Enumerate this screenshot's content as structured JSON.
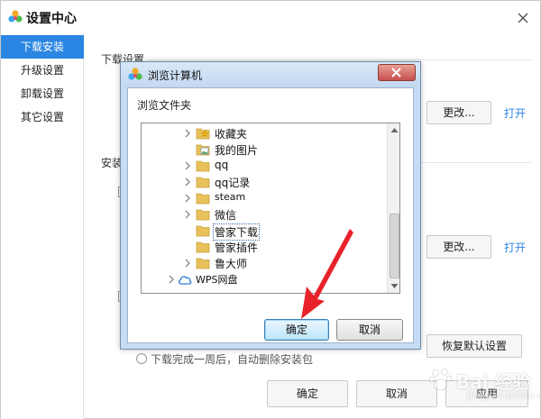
{
  "window": {
    "title": "设置中心"
  },
  "sidebar": {
    "items": [
      {
        "label": "下载安装",
        "active": true
      },
      {
        "label": "升级设置",
        "active": false
      },
      {
        "label": "卸载设置",
        "active": false
      },
      {
        "label": "其它设置",
        "active": false
      }
    ]
  },
  "content": {
    "download_section_title": "下载设置",
    "install_section_partial": "安装",
    "change_button_label": "更改...",
    "open_link_label": "打开",
    "restore_default_label": "恢复默认设置",
    "partial_option_text": "下载完成一周后，自动删除安装包",
    "ok_label": "确定",
    "cancel_label": "取消",
    "apply_label": "应用"
  },
  "dialog": {
    "title": "浏览计算机",
    "description": "浏览文件夹",
    "tree": [
      {
        "label": "收藏夹",
        "icon": "star-folder-icon",
        "expandable": true,
        "selected": false
      },
      {
        "label": "我的图片",
        "icon": "picture-folder-icon",
        "expandable": false,
        "selected": false
      },
      {
        "label": "qq",
        "icon": "folder-icon",
        "expandable": true,
        "selected": false
      },
      {
        "label": "qq记录",
        "icon": "folder-icon",
        "expandable": true,
        "selected": false
      },
      {
        "label": "steam",
        "icon": "folder-icon",
        "expandable": true,
        "selected": false
      },
      {
        "label": "微信",
        "icon": "folder-icon",
        "expandable": true,
        "selected": false
      },
      {
        "label": "管家下载",
        "icon": "folder-icon",
        "expandable": false,
        "selected": true
      },
      {
        "label": "管家插件",
        "icon": "folder-icon",
        "expandable": false,
        "selected": false
      },
      {
        "label": "鲁大师",
        "icon": "folder-icon",
        "expandable": true,
        "selected": false
      },
      {
        "label": "WPS网盘",
        "icon": "cloud-icon",
        "expandable": true,
        "selected": false
      }
    ],
    "ok_label": "确定",
    "cancel_label": "取消"
  },
  "watermark": {
    "text": "Bai 经验",
    "sub": "jingyan.baidu.com"
  },
  "colors": {
    "accent": "#2a86e2",
    "dialog_frame": "#c7dcf2",
    "arrow_red": "#e8222b"
  }
}
